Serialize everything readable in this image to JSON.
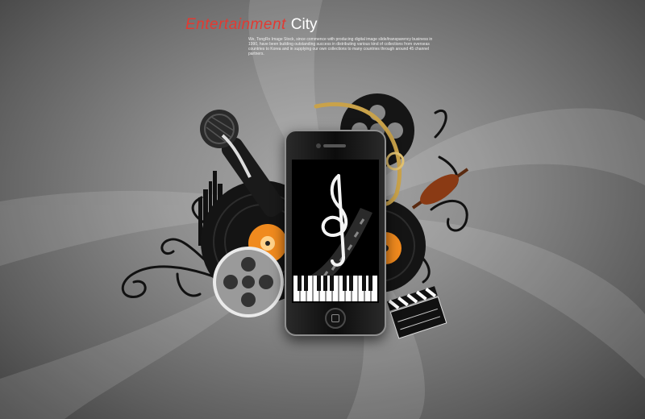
{
  "title": {
    "word1": "Entertainment",
    "word2": "City"
  },
  "blurb": "We, TongRo Image Stock, since commence with producing digital image slide/transparency business in 1990, have been building outstanding success in distributing various kind of collections from overseas countries to Korea and in supplying our own collections to many countries through around 45 channel partners.",
  "colors": {
    "title_accent": "#e23a32",
    "title_secondary": "#ffffff",
    "vinyl_label": "#f08a1e",
    "background": "#8d8d8d"
  },
  "icons": [
    "microphone-icon",
    "saxophone-icon",
    "film-reel-icon",
    "violin-icon",
    "vinyl-record-icon",
    "smartphone-icon",
    "treble-clef-icon",
    "piano-keys-icon",
    "clapperboard-icon",
    "city-skyline-icon",
    "flourish-icon"
  ]
}
